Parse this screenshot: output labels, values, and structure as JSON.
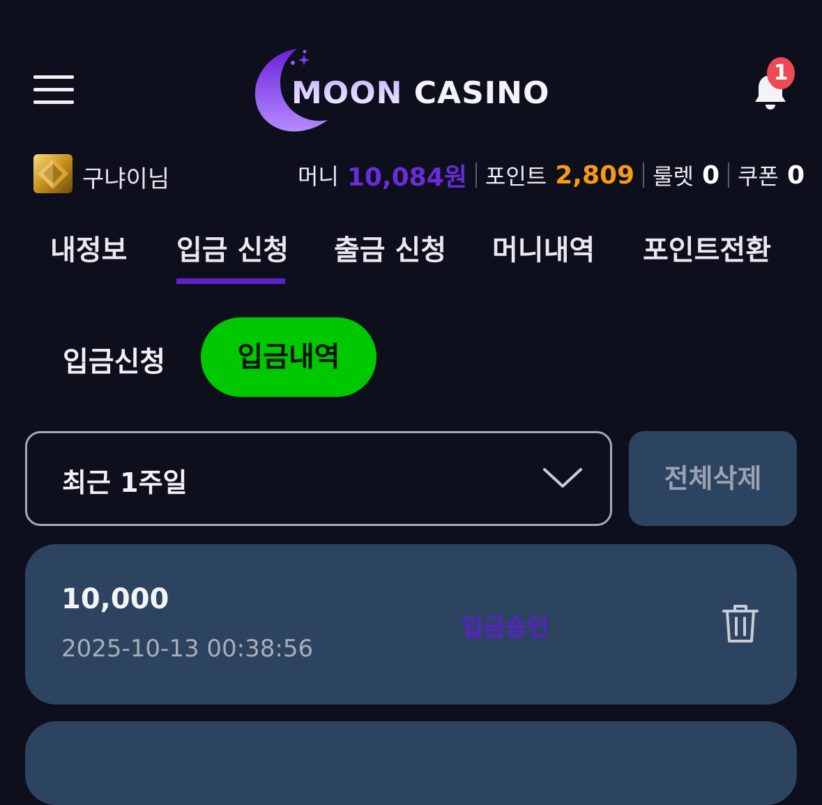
{
  "header": {
    "logo_word1": "MOON",
    "logo_word2": "CASINO",
    "notification_count": "1"
  },
  "user": {
    "name": "구냐이님",
    "money_label": "머니",
    "money_value": "10,084원",
    "point_label": "포인트",
    "point_value": "2,809",
    "roulette_label": "룰렛",
    "roulette_value": "0",
    "coupon_label": "쿠폰",
    "coupon_value": "0"
  },
  "tabs": [
    {
      "label": "내정보",
      "active": false
    },
    {
      "label": "입금 신청",
      "active": true
    },
    {
      "label": "출금 신청",
      "active": false
    },
    {
      "label": "머니내역",
      "active": false
    },
    {
      "label": "포인트전환",
      "active": false
    }
  ],
  "subtabs": [
    {
      "label": "입금신청",
      "active": false
    },
    {
      "label": "입금내역",
      "active": true
    }
  ],
  "filter": {
    "selected": "최근 1주일",
    "delete_all_label": "전체삭제"
  },
  "records": [
    {
      "amount": "10,000",
      "datetime": "2025-10-13 00:38:56",
      "status": "입금승인"
    }
  ],
  "colors": {
    "background": "#0e0f1d",
    "accent_purple": "#5d23c9",
    "money_purple": "#6a2bd9",
    "point_orange": "#f59a11",
    "active_green": "#00c800",
    "card_bg": "#2d4460",
    "badge_red": "#ec4a55"
  },
  "icons": {
    "menu": "hamburger-icon",
    "logo": "crescent-moon-icon",
    "notifications": "bell-icon",
    "avatar": "gold-gem-icon",
    "dropdown": "chevron-down-icon",
    "delete": "trash-icon"
  }
}
